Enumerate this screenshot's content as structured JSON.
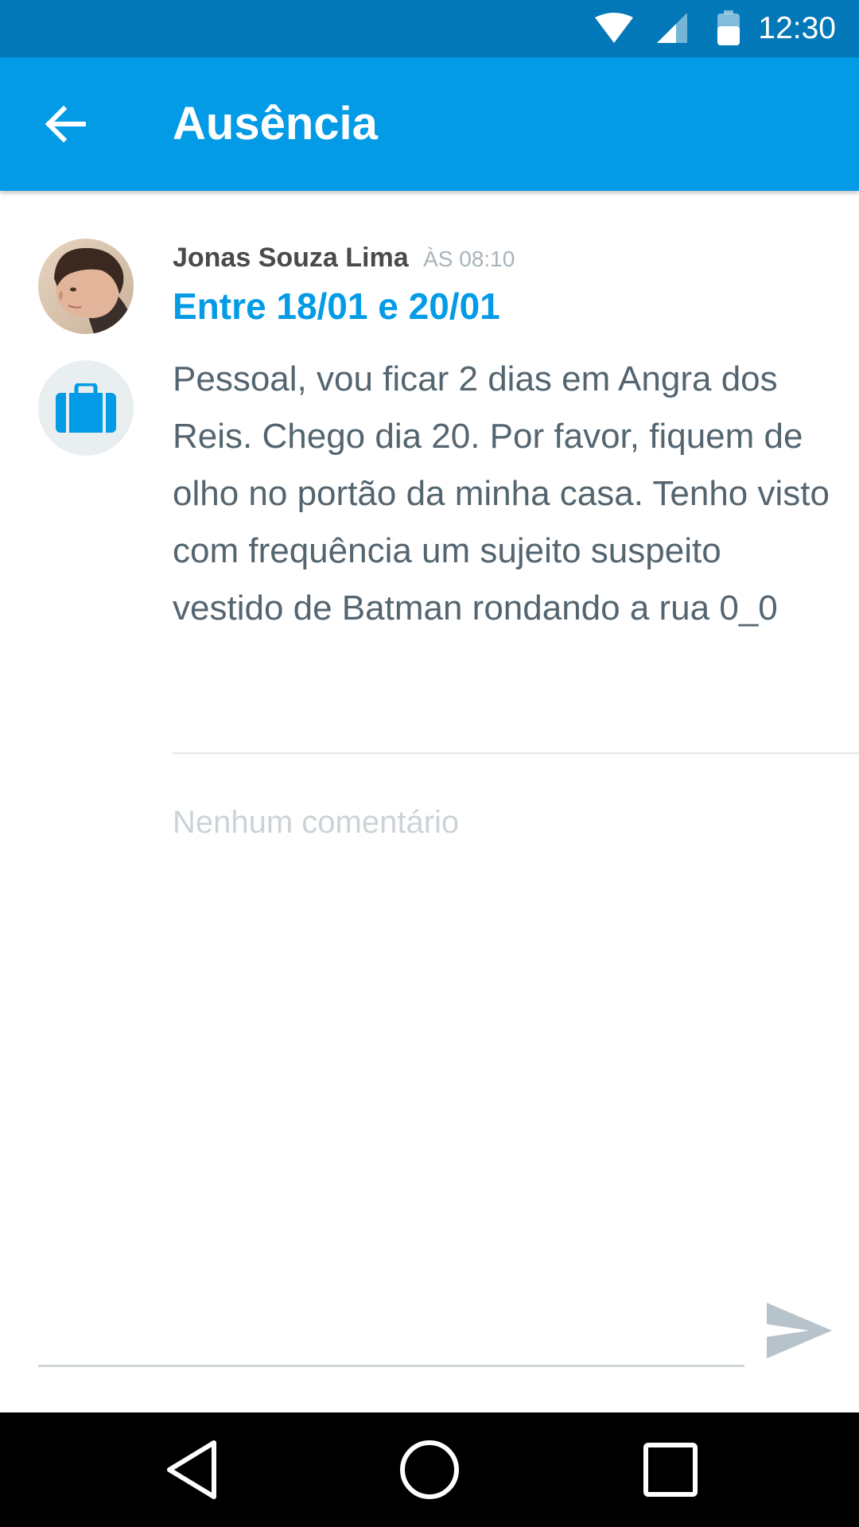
{
  "status_bar": {
    "time": "12:30",
    "icons": [
      "wifi-icon",
      "cell-signal-icon",
      "battery-icon"
    ]
  },
  "app_bar": {
    "back_icon": "arrow-left-icon",
    "title": "Ausência"
  },
  "post": {
    "author": "Jonas Souza Lima",
    "time": "ÀS 08:10",
    "date_range": "Entre 18/01 e 20/01",
    "category_icon": "briefcase-icon",
    "body": "Pessoal, vou ficar 2 dias em Angra dos Reis. Chego dia 20. Por favor, fiquem de olho no portão da minha casa. Tenho visto com frequência um sujeito suspeito vestido de Batman rondando a rua 0_0"
  },
  "comments": {
    "empty_text": "Nenhum comentário"
  },
  "comment_input": {
    "value": "",
    "placeholder": "",
    "send_icon": "send-icon"
  },
  "nav_bar": {
    "buttons": [
      "back-triangle-icon",
      "home-circle-icon",
      "recents-square-icon"
    ]
  },
  "colors": {
    "status_bar": "#0278b8",
    "app_bar": "#039be5",
    "accent": "#039be5",
    "body_text": "#546570",
    "muted_text": "#ccd3d7"
  }
}
